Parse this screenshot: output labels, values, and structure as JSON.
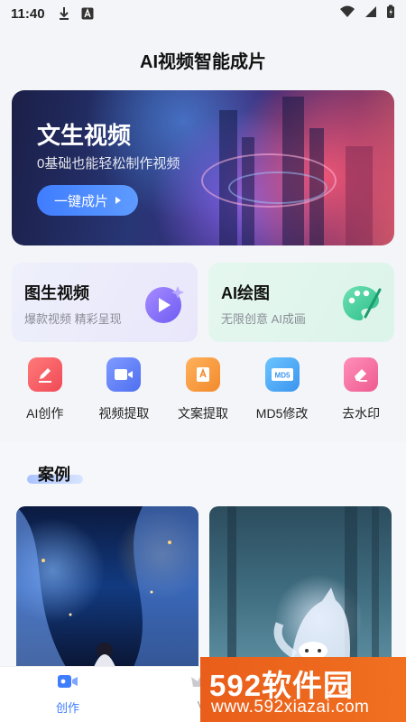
{
  "status_bar": {
    "time": "11:40"
  },
  "header": {
    "title": "AI视频智能成片"
  },
  "hero": {
    "title": "文生视频",
    "subtitle": "0基础也能轻松制作视频",
    "button_label": "一键成片"
  },
  "feature_cards": [
    {
      "title": "图生视频",
      "subtitle": "爆款视频 精彩呈现"
    },
    {
      "title": "AI绘图",
      "subtitle": "无限创意 AI成画"
    }
  ],
  "tools": [
    {
      "label": "AI创作",
      "icon": "pen-icon",
      "color": "#f0575d"
    },
    {
      "label": "视频提取",
      "icon": "video-camera-icon",
      "color": "#5b7cf4"
    },
    {
      "label": "文案提取",
      "icon": "text-document-icon",
      "color": "#f2933a"
    },
    {
      "label": "MD5修改",
      "icon": "md5-icon",
      "color": "#45a3f2"
    },
    {
      "label": "去水印",
      "icon": "eraser-icon",
      "color": "#f46b9b"
    }
  ],
  "cases_section": {
    "title": "案例"
  },
  "bottom_nav": {
    "create_label": "创作",
    "vip_label": "V"
  },
  "watermark": {
    "brand": "592软件园",
    "url": "www.592xiazai.com"
  },
  "colors": {
    "accent": "#3f7dff",
    "watermark": "#ef6a1e"
  }
}
